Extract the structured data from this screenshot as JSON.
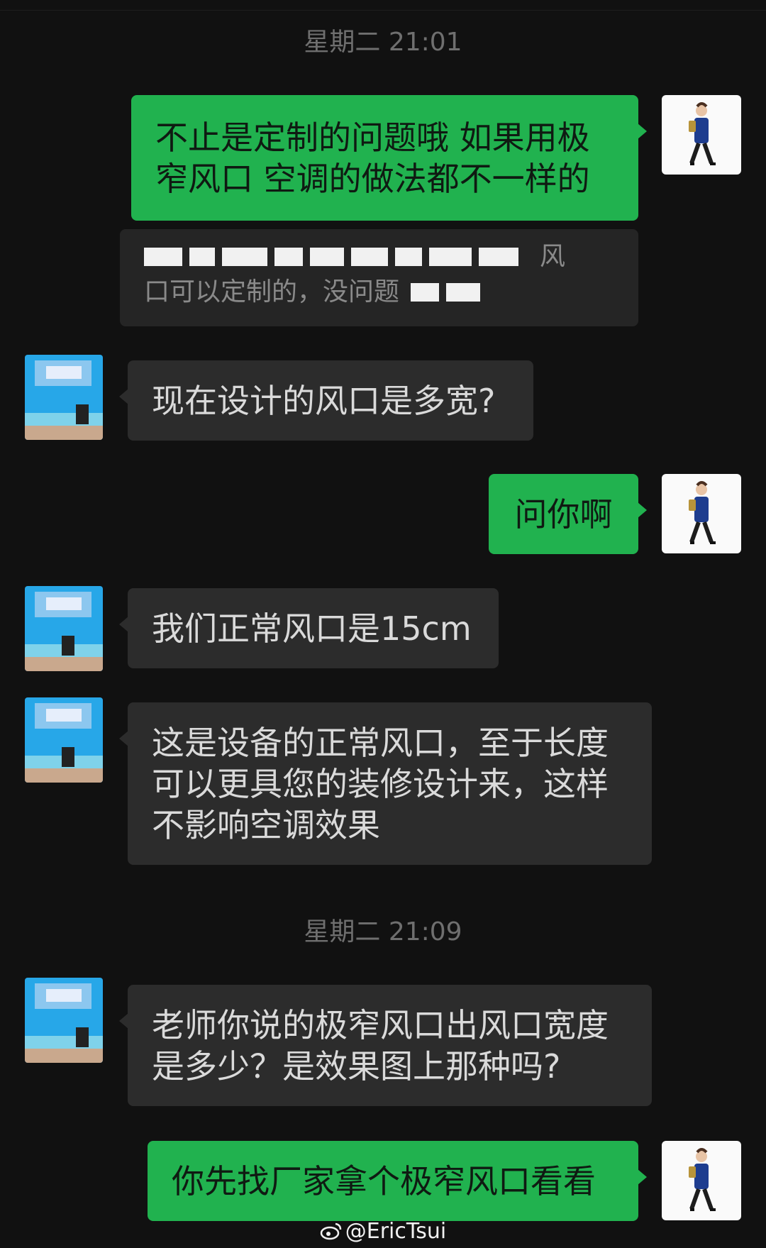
{
  "timestamps": [
    "星期二 21:01",
    "星期二 21:09"
  ],
  "messages": [
    {
      "side": "out",
      "text": "不止是定制的问题哦  如果用极\n窄风口  空调的做法都不一样的"
    },
    {
      "side": "quote",
      "lines": [
        "风",
        "口可以定制的，没问题"
      ]
    },
    {
      "side": "in",
      "text": "现在设计的风口是多宽?"
    },
    {
      "side": "out",
      "text": "问你啊"
    },
    {
      "side": "in",
      "text": "我们正常风口是15cm"
    },
    {
      "side": "in",
      "text": "这是设备的正常风口，至于长度\n可以更具您的装修设计来，这样\n不影响空调效果"
    },
    {
      "side": "in",
      "text": "老师你说的极窄风口出风口宽度\n是多少？是效果图上那种吗?"
    },
    {
      "side": "out",
      "text": "你先找厂家拿个极窄风口看看"
    }
  ],
  "watermark": {
    "icon": "weibo-icon",
    "handle": "@EricTsui"
  },
  "colors": {
    "background": "#111111",
    "outgoing": "#21b24f",
    "incoming": "#2c2c2c"
  }
}
